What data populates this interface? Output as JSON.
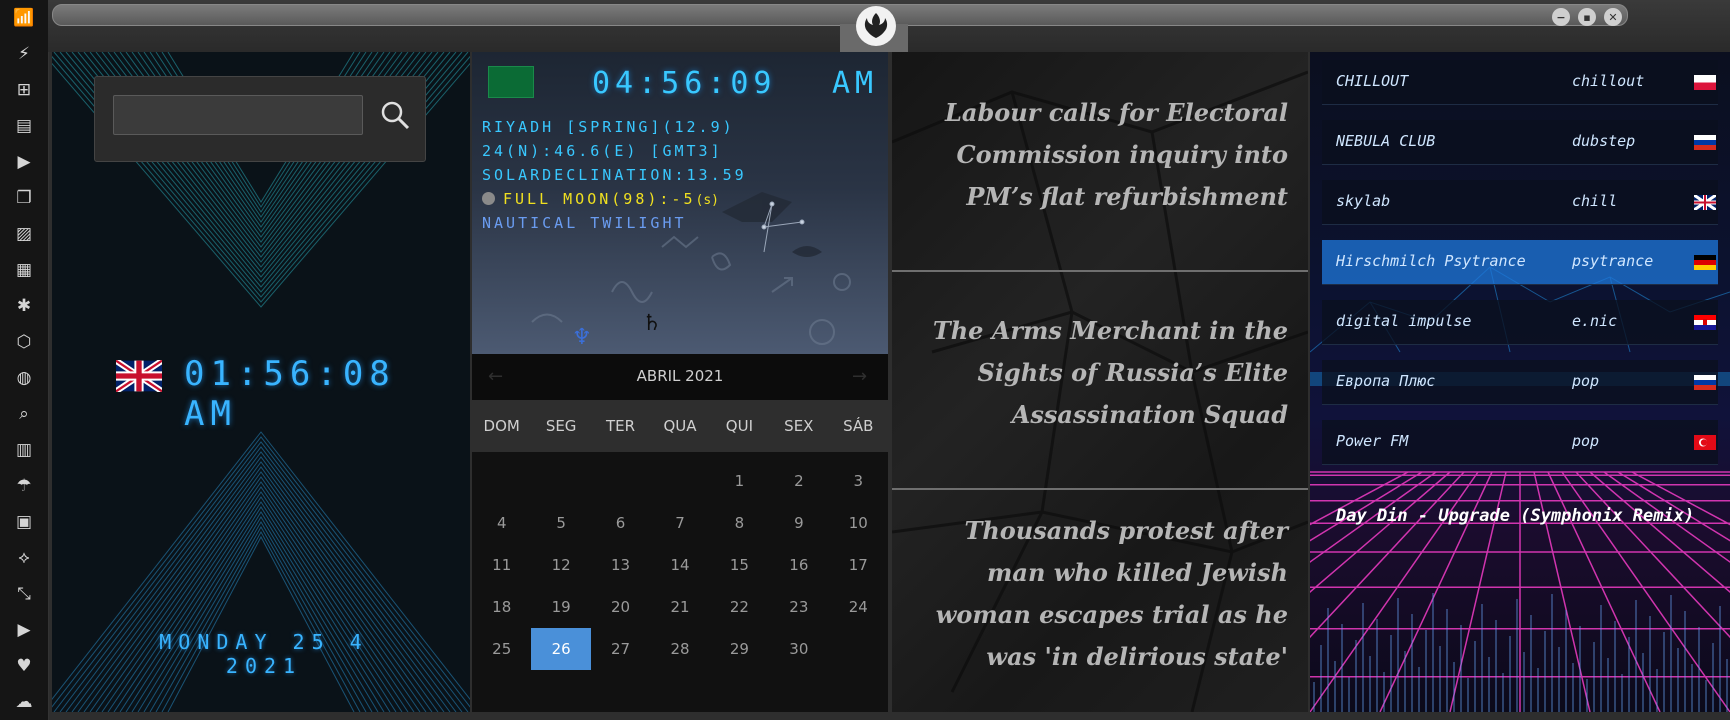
{
  "sidebar": {
    "icons": [
      "wifi-icon",
      "bolt-icon",
      "windows-icon",
      "archive-icon",
      "play-icon",
      "book-icon",
      "image-icon",
      "news-icon",
      "aperture-icon",
      "shield-hex-icon",
      "globe-icon",
      "search-icon",
      "map-icon",
      "umbrella-icon",
      "contact-icon",
      "link-icon",
      "expand-icon",
      "youtube-icon",
      "heart-icon",
      "cloud-icon"
    ],
    "glyphs": [
      "📶",
      "⚡",
      "⊞",
      "▤",
      "▶",
      "❐",
      "▨",
      "▦",
      "✱",
      "⬡",
      "◍",
      "⌕",
      "▥",
      "☂",
      "▣",
      "⟡",
      "⤡",
      "▶",
      "♥",
      "☁"
    ]
  },
  "titlebar": {
    "controls": [
      "−",
      "▪",
      "✕"
    ]
  },
  "clock_uk": {
    "time": "01:56:08 AM",
    "date": "MONDAY 25 4 2021"
  },
  "search": {
    "value": "",
    "placeholder": ""
  },
  "riyadh": {
    "time": "04:56:09",
    "ampm": "AM",
    "line1": "RIYADH [SPRING](12.9)",
    "line2": "24(N):46.6(E) [GMT3]",
    "line3": "SOLARDECLINATION:13.59",
    "line4": "FULL MOON(98):-5",
    "line4_suffix": "(s)",
    "line5": "NAUTICAL TWILIGHT"
  },
  "calendar": {
    "month": "ABRIL 2021",
    "prev": "←",
    "next": "→",
    "weekdays": [
      "DOM",
      "SEG",
      "TER",
      "QUA",
      "QUI",
      "SEX",
      "SÁB"
    ],
    "days": [
      "",
      "",
      "",
      "",
      "1",
      "2",
      "3",
      "4",
      "5",
      "6",
      "7",
      "8",
      "9",
      "10",
      "11",
      "12",
      "13",
      "14",
      "15",
      "16",
      "17",
      "18",
      "19",
      "20",
      "21",
      "22",
      "23",
      "24",
      "25",
      "26",
      "27",
      "28",
      "29",
      "30",
      ""
    ],
    "selected": "26"
  },
  "news": [
    {
      "headline": "Labour calls for Electoral Commission inquiry into PM’s flat refurbishment"
    },
    {
      "headline": "The Arms Merchant in the Sights of Russia’s Elite Assassination Squad"
    },
    {
      "headline": "Thousands protest after man who killed Jewish woman escapes trial as he was 'in delirious state'"
    }
  ],
  "radio": {
    "stations": [
      {
        "name": "CHILLOUT",
        "genre": "chillout",
        "flag": "poland"
      },
      {
        "name": "NEBULA CLUB",
        "genre": "dubstep",
        "flag": "russia"
      },
      {
        "name": "skylab",
        "genre": "chill",
        "flag": "uk"
      },
      {
        "name": "Hirschmilch Psytrance",
        "genre": "psytrance",
        "flag": "germany"
      },
      {
        "name": "digital impulse",
        "genre": "e.nic",
        "flag": "croatia"
      },
      {
        "name": "Европа Плюс",
        "genre": "pop",
        "flag": "russia"
      },
      {
        "name": "Power FM",
        "genre": "pop",
        "flag": "turkey"
      }
    ],
    "active_index": 3,
    "now_playing": "Day Din - Upgrade (Symphonix Remix)"
  },
  "colors": {
    "digital": "#39b4ff",
    "yellow": "#f0e020",
    "selected_day": "#4a90d9",
    "active_station": "#1e78dc"
  }
}
